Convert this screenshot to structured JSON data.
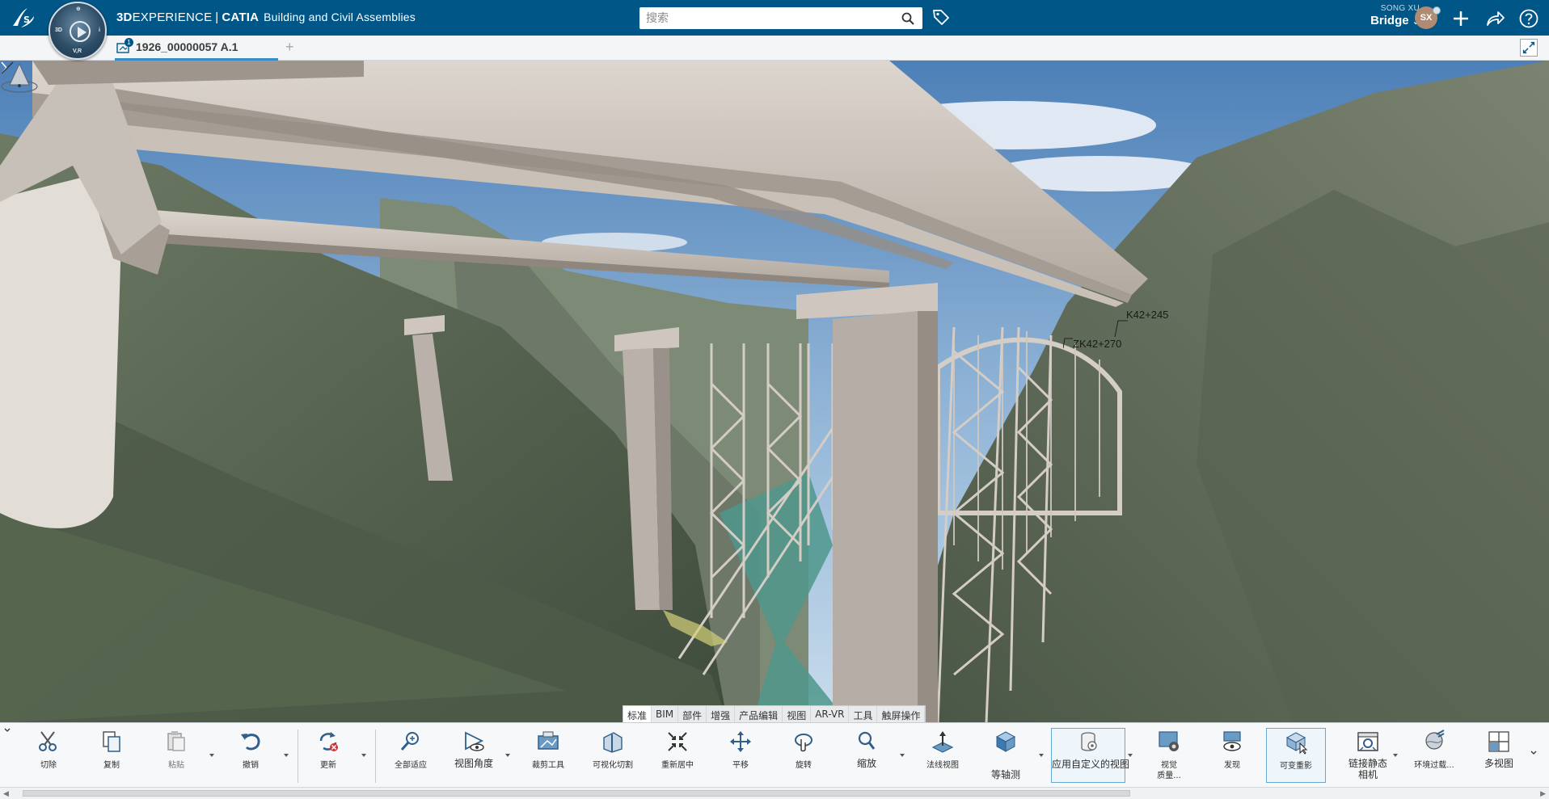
{
  "header": {
    "brand_bold": "3D",
    "brand_light": "EXPERIENCE",
    "separator": "|",
    "product": "CATIA",
    "app_name": "Building and Civil Assemblies",
    "compass_labels": {
      "top": "⊕",
      "left": "3D",
      "right": "i",
      "bottom": "V,R"
    },
    "search_placeholder": "搜索",
    "user_name": "SONG XU",
    "space_name": "Bridge",
    "avatar_initials": "SX"
  },
  "document_tab": {
    "title": "1926_00000057 A.1",
    "badge": "1",
    "add_label": "+"
  },
  "viewport": {
    "annotations": [
      "K42+245",
      "ZK42+270"
    ]
  },
  "section_tabs": [
    "标准",
    "BIM",
    "部件",
    "增强",
    "产品编辑",
    "视图",
    "AR-VR",
    "工具",
    "触屏操作"
  ],
  "section_tab_active": "标准",
  "toolbar": {
    "cut": "切除",
    "copy": "复制",
    "paste": "粘贴",
    "undo": "撤销",
    "update": "更新",
    "fit_all": "全部适应",
    "view_angle": "视图角度",
    "clipping_tool": "裁剪工具",
    "visual_cut": "可视化切割",
    "recenter": "重新居中",
    "pan": "平移",
    "rotate": "旋转",
    "zoom": "缩放",
    "normal_view": "法线视图",
    "isometric": "等轴测",
    "apply_custom_view": "应用自定义的视图",
    "visual_quality_line1": "视觉",
    "visual_quality_line2": "质量...",
    "discover": "发现",
    "variable_ghost": "可变重影",
    "link_static_camera_line1": "链接静态",
    "link_static_camera_line2": "相机",
    "env_filter": "环境过载...",
    "multi_view": "多视图"
  },
  "colors": {
    "topbar": "#005686",
    "accent": "#368ec4",
    "highlight_border": "#6aa8d4"
  }
}
